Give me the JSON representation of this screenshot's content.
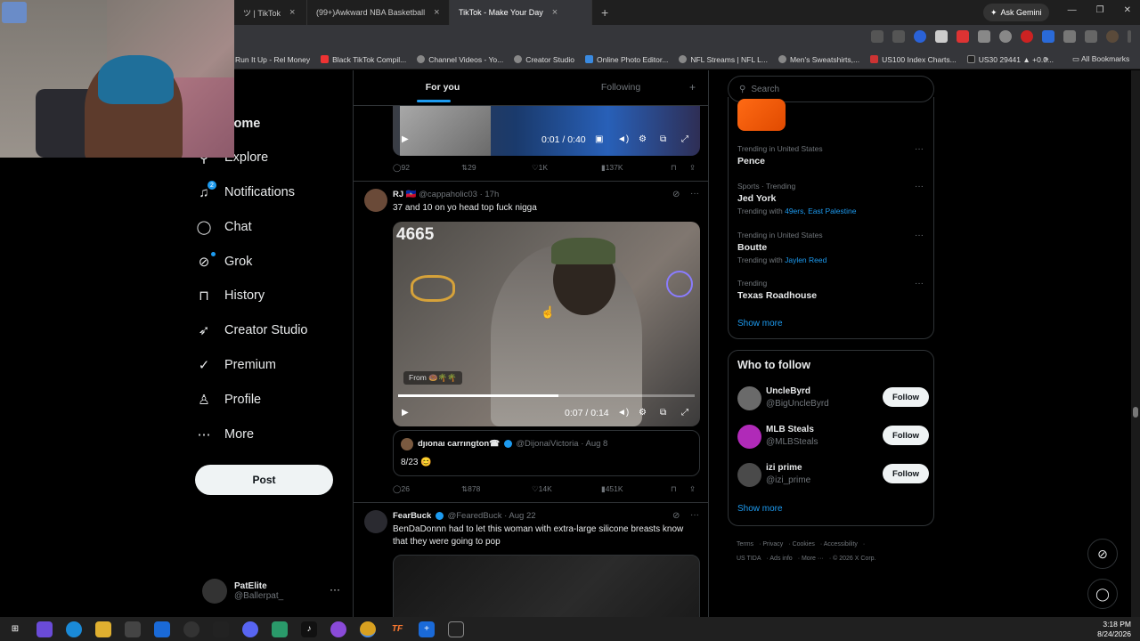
{
  "browser": {
    "tabs": [
      {
        "label": "ツ | TikTok",
        "active": false
      },
      {
        "label": "(99+)Awkward NBA Basketball",
        "active": false
      },
      {
        "label": "TikTok - Make Your Day",
        "active": false
      }
    ],
    "new_tab": "+",
    "ask_gemini": "Ask Gemini",
    "bookmarks": [
      "Run It Up - Rel Money",
      "Black TikTok Compil...",
      "Channel Videos - Yo...",
      "Creator Studio",
      "Online Photo Editor...",
      "NFL Streams | NFL L...",
      "Men's Sweatshirts,...",
      "US100 Index Charts...",
      "US30 29441 ▲ +0.0..."
    ],
    "bookmarks_all": "All Bookmarks"
  },
  "nav": {
    "items": [
      {
        "label": "Home",
        "icon": "home-icon"
      },
      {
        "label": "Explore",
        "icon": "search-icon"
      },
      {
        "label": "Notifications",
        "icon": "bell-icon",
        "badge": "2"
      },
      {
        "label": "Chat",
        "icon": "chat-icon"
      },
      {
        "label": "Grok",
        "icon": "grok-icon"
      },
      {
        "label": "History",
        "icon": "bookmark-icon"
      },
      {
        "label": "Creator Studio",
        "icon": "rocket-icon"
      },
      {
        "label": "Premium",
        "icon": "verified-icon"
      },
      {
        "label": "Profile",
        "icon": "person-icon"
      },
      {
        "label": "More",
        "icon": "more-circle-icon"
      }
    ],
    "post_label": "Post",
    "account": {
      "name": "PatElite",
      "handle": "@Ballerpat_"
    }
  },
  "feed": {
    "tabs": [
      "For you",
      "Following"
    ],
    "active_tab": "For you",
    "top_video": {
      "time": "0:01 / 0:40"
    },
    "top_actions": {
      "replies": "92",
      "reposts": "29",
      "likes": "1K",
      "views": "137K"
    },
    "tweet1": {
      "name": "RJ",
      "flag": "🇭🇹",
      "handle": "@cappaholic03",
      "time": "17h",
      "text": "37 and 10 on yo head top fuck nigga",
      "video_overlay": "4665",
      "from_label": "From 🍩🌴🌴",
      "video_time": "0:07 / 0:14",
      "progress": 0.54,
      "quote": {
        "name": "dȷıonaı carrıngton☎",
        "handle": "@DijonaiVictoria",
        "time": "Aug 8",
        "text": "8/23 😊"
      },
      "actions": {
        "replies": "26",
        "reposts": "878",
        "likes": "14K",
        "views": "451K"
      }
    },
    "tweet2": {
      "name": "FearBuck",
      "handle": "@FearedBuck",
      "time": "Aug 22",
      "text": "BenDaDonnn had to let this woman with extra-large silicone breasts know that they were going to pop"
    }
  },
  "right": {
    "search_placeholder": "Search",
    "trends": [
      {
        "context": "Trending in United States",
        "name": "Pence",
        "with": "",
        "links": ""
      },
      {
        "context": "Sports · Trending",
        "name": "Jed York",
        "with": "Trending with",
        "links": "49ers, East Palestine"
      },
      {
        "context": "Trending in United States",
        "name": "Boutte",
        "with": "Trending with",
        "links": "Jaylen Reed"
      },
      {
        "context": "Trending",
        "name": "Texas Roadhouse",
        "with": "",
        "links": ""
      }
    ],
    "show_more": "Show more",
    "who_to_follow": {
      "title": "Who to follow",
      "users": [
        {
          "name": "UncleByrd",
          "handle": "@BigUncleByrd"
        },
        {
          "name": "MLB Steals",
          "handle": "@MLBSteals"
        },
        {
          "name": "izi prime",
          "handle": "@izi_prime"
        }
      ],
      "follow_label": "Follow",
      "show_more": "Show more"
    },
    "footer": {
      "line1": [
        "Terms",
        "Privacy",
        "Cookies",
        "Accessibility"
      ],
      "line2": [
        "US TIDA",
        "Ads info",
        "More ···",
        "© 2026 X Corp."
      ]
    }
  },
  "taskbar": {
    "time": "3:18 PM",
    "date": "8/24/2026"
  }
}
